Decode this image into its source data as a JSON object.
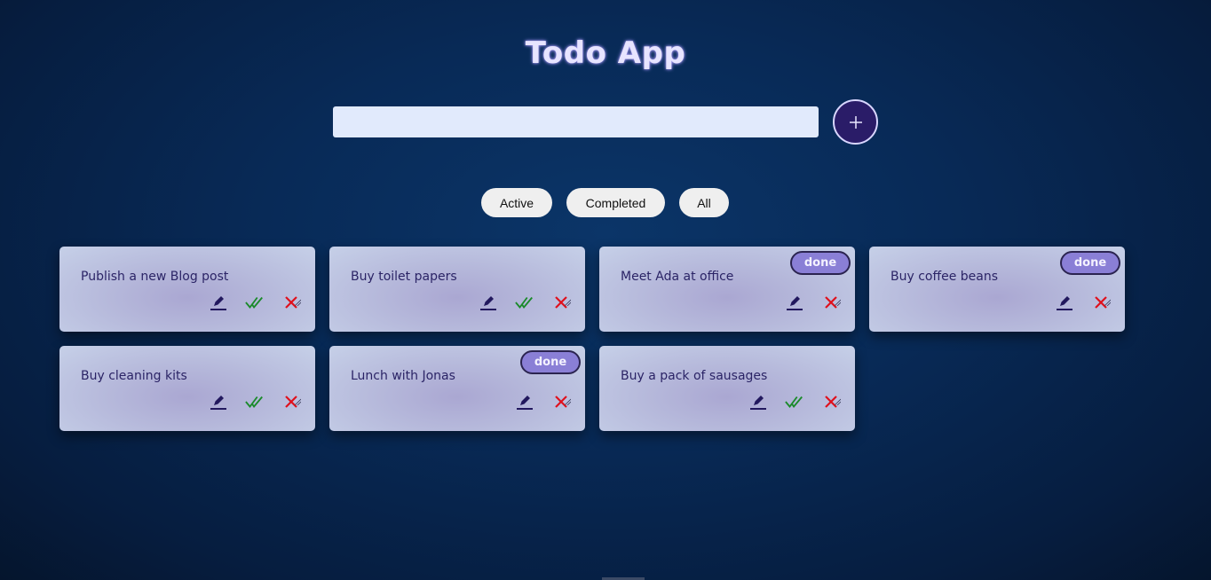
{
  "app": {
    "title": "Todo App"
  },
  "input": {
    "value": "",
    "placeholder": ""
  },
  "add_button": {
    "icon": "plus-icon"
  },
  "filters": [
    {
      "label": "Active"
    },
    {
      "label": "Completed"
    },
    {
      "label": "All"
    }
  ],
  "todos": [
    {
      "text": "Publish a new Blog post",
      "done": false
    },
    {
      "text": "Buy toilet papers",
      "done": false
    },
    {
      "text": "Meet Ada at office",
      "done": true
    },
    {
      "text": "Buy coffee beans",
      "done": true
    },
    {
      "text": "Buy cleaning kits",
      "done": false
    },
    {
      "text": "Lunch with Jonas",
      "done": true
    },
    {
      "text": "Buy a pack of sausages",
      "done": false
    }
  ],
  "done_label": "done",
  "colors": {
    "edit": "#22185e",
    "complete": "#1a8a2a",
    "delete": "#e0101c",
    "badge": "#8a7fd6",
    "title_glow": "#a59af2",
    "accent": "#2a1c68"
  },
  "icons": {
    "edit": "pencil-icon",
    "complete": "double-check-icon",
    "delete": "close-icon"
  }
}
